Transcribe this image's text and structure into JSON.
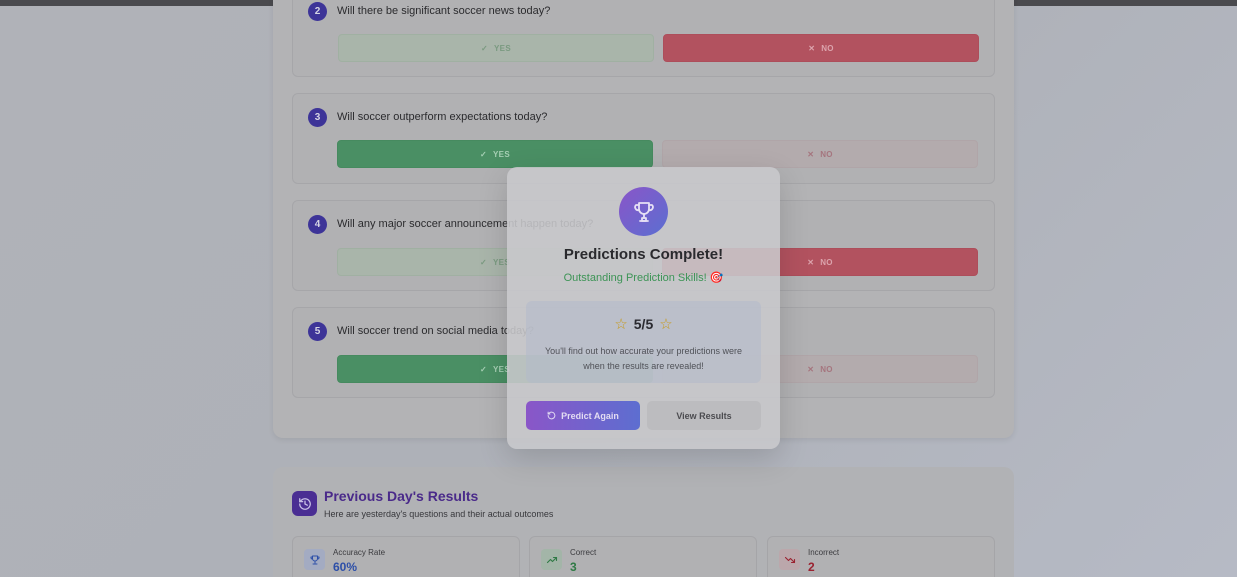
{
  "questions": [
    {
      "num": "2",
      "text": "Will there be significant soccer news today?",
      "selected": "no"
    },
    {
      "num": "3",
      "text": "Will soccer outperform expectations today?",
      "selected": "yes"
    },
    {
      "num": "4",
      "text": "Will any major soccer announcement happen today?",
      "selected": "no"
    },
    {
      "num": "5",
      "text": "Will soccer trend on social media today?",
      "selected": "yes"
    }
  ],
  "answers": {
    "yes_label": "YES",
    "no_label": "NO"
  },
  "modal": {
    "title": "Predictions Complete!",
    "subtitle": "Outstanding Prediction Skills! 🎯",
    "score": "5/5",
    "note": "You'll find out how accurate your predictions were when the results are revealed!",
    "predict_again_label": "Predict Again",
    "view_results_label": "View Results"
  },
  "results": {
    "title": "Previous Day's Results",
    "subtitle": "Here are yesterday's questions and their actual outcomes",
    "stats": [
      {
        "label": "Accuracy Rate",
        "value": "60%",
        "color": "#2d4fa8",
        "icon": "trophy-icon"
      },
      {
        "label": "Correct",
        "value": "3",
        "color": "#2f7a45",
        "icon": "trending-up-icon"
      },
      {
        "label": "Incorrect",
        "value": "2",
        "color": "#9a2230",
        "icon": "trending-down-icon"
      }
    ]
  },
  "colors": {
    "accent": "#6a4fc8",
    "success": "#3d9456",
    "danger": "#b2525f"
  }
}
